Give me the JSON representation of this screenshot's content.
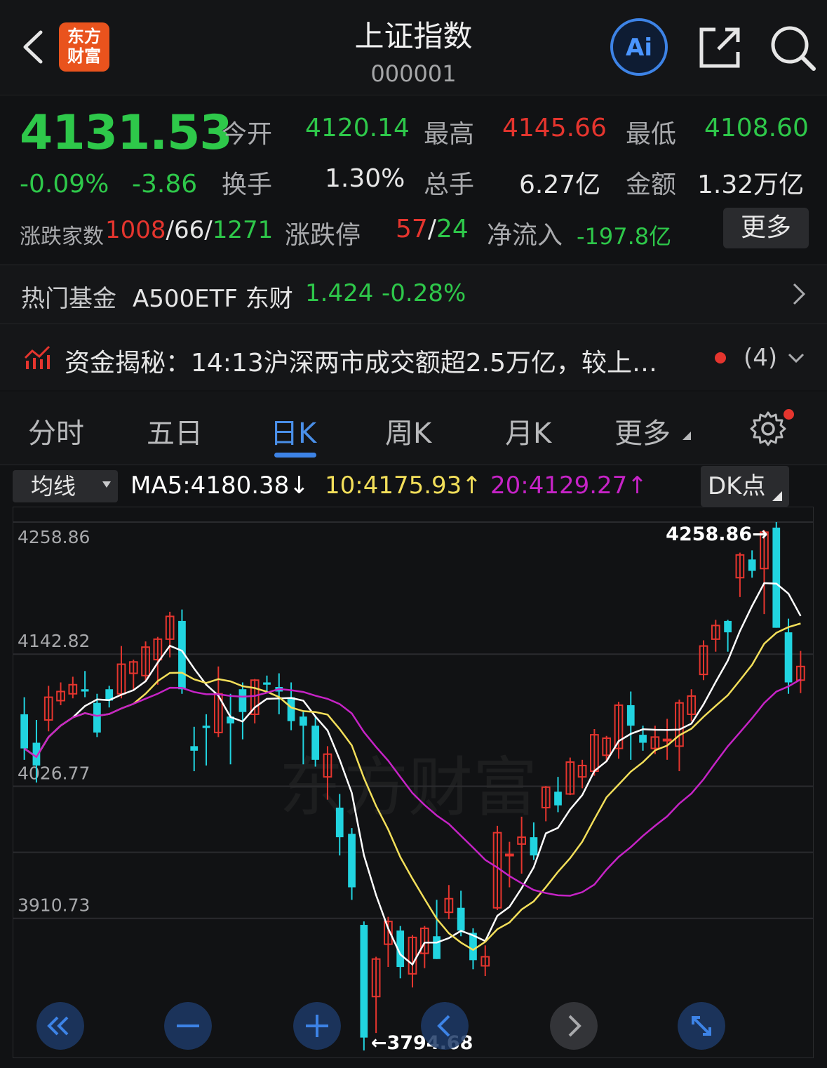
{
  "header": {
    "logo_line1": "东方",
    "logo_line2": "财富",
    "title": "上证指数",
    "code": "000001",
    "ai_label": "Ai"
  },
  "quote": {
    "price": "4131.53",
    "change_pct": "-0.09%",
    "change": "-3.86",
    "open_label": "今开",
    "open": "4120.14",
    "high_label": "最高",
    "high": "4145.66",
    "low_label": "最低",
    "low": "4108.60",
    "turnover_label": "换手",
    "turnover": "1.30%",
    "volume_label": "总手",
    "volume": "6.27亿",
    "amount_label": "金额",
    "amount": "1.32万亿",
    "breadth_label": "涨跌家数",
    "breadth_up": "1008",
    "breadth_flat": "66",
    "breadth_down": "1271",
    "limit_label": "涨跌停",
    "limit_up": "57",
    "limit_down": "24",
    "inflow_label": "净流入",
    "inflow": "-197.8亿",
    "more_label": "更多"
  },
  "fund": {
    "label": "热门基金",
    "name": "A500ETF 东财",
    "price": "1.424",
    "change": "-0.28%"
  },
  "news": {
    "text": "资金揭秘：14:13沪深两市成交额超2.5万亿，较上…",
    "count": "(4)"
  },
  "tabs": [
    "分时",
    "五日",
    "日K",
    "周K",
    "月K",
    "更多"
  ],
  "ma": {
    "type_label": "均线",
    "ma5": "MA5:4180.38",
    "ma5_arrow": "↓",
    "ma10": "10:4175.93",
    "ma10_arrow": "↑",
    "ma20": "20:4129.27",
    "ma20_arrow": "↑",
    "dk_label": "DK点"
  },
  "colors": {
    "up": "#e5352e",
    "down": "#2ec84a",
    "candle_down": "#21d4e0",
    "ma5": "#ffffff",
    "ma10": "#f3df5a",
    "ma20": "#c623c6",
    "accent": "#3d83e6"
  },
  "chart_data": {
    "type": "candlestick",
    "y_ticks": [
      "4258.86",
      "4142.82",
      "4026.77",
      "3910.73"
    ],
    "ylim": [
      3794.68,
      4258.86
    ],
    "max_label": "4258.86",
    "min_label": "3794.68",
    "grid": true,
    "candles": [
      {
        "o": 4090,
        "c": 4060,
        "h": 4105,
        "l": 4050
      },
      {
        "o": 4065,
        "c": 4045,
        "h": 4085,
        "l": 4030
      },
      {
        "o": 4085,
        "c": 4105,
        "h": 4115,
        "l": 4075
      },
      {
        "o": 4102,
        "c": 4110,
        "h": 4118,
        "l": 4098
      },
      {
        "o": 4108,
        "c": 4116,
        "h": 4123,
        "l": 4104
      },
      {
        "o": 4112,
        "c": 4110,
        "h": 4128,
        "l": 4105
      },
      {
        "o": 4100,
        "c": 4074,
        "h": 4108,
        "l": 4070
      },
      {
        "o": 4112,
        "c": 4102,
        "h": 4115,
        "l": 4096
      },
      {
        "o": 4108,
        "c": 4134,
        "h": 4150,
        "l": 4104
      },
      {
        "o": 4126,
        "c": 4136,
        "h": 4138,
        "l": 4111
      },
      {
        "o": 4124,
        "c": 4149,
        "h": 4154,
        "l": 4119
      },
      {
        "o": 4138,
        "c": 4156,
        "h": 4158,
        "l": 4116
      },
      {
        "o": 4156,
        "c": 4176,
        "h": 4180,
        "l": 4140
      },
      {
        "o": 4172,
        "c": 4112,
        "h": 4182,
        "l": 4108
      },
      {
        "o": 4062,
        "c": 4058,
        "h": 4079,
        "l": 4040
      },
      {
        "o": 4080,
        "c": 4078,
        "h": 4090,
        "l": 4045
      },
      {
        "o": 4074,
        "c": 4108,
        "h": 4132,
        "l": 4070
      },
      {
        "o": 4088,
        "c": 4082,
        "h": 4108,
        "l": 4046
      },
      {
        "o": 4112,
        "c": 4092,
        "h": 4118,
        "l": 4068
      },
      {
        "o": 4090,
        "c": 4120,
        "h": 4121,
        "l": 4082
      },
      {
        "o": 4118,
        "c": 4116,
        "h": 4124,
        "l": 4110
      },
      {
        "o": 4114,
        "c": 4110,
        "h": 4126,
        "l": 4090
      },
      {
        "o": 4105,
        "c": 4084,
        "h": 4118,
        "l": 4076
      },
      {
        "o": 4088,
        "c": 4080,
        "h": 4092,
        "l": 4046
      },
      {
        "o": 4080,
        "c": 4050,
        "h": 4088,
        "l": 4044
      },
      {
        "o": 4035,
        "c": 4055,
        "h": 4062,
        "l": 4015
      },
      {
        "o": 4008,
        "c": 3982,
        "h": 4020,
        "l": 3966
      },
      {
        "o": 3985,
        "c": 3938,
        "h": 3990,
        "l": 3927
      },
      {
        "o": 3905,
        "c": 3806,
        "h": 3908,
        "l": 3794.68
      },
      {
        "o": 3842,
        "c": 3875,
        "h": 3877,
        "l": 3810
      },
      {
        "o": 3888,
        "c": 3908,
        "h": 3912,
        "l": 3868
      },
      {
        "o": 3900,
        "c": 3868,
        "h": 3904,
        "l": 3858
      },
      {
        "o": 3862,
        "c": 3894,
        "h": 3896,
        "l": 3850
      },
      {
        "o": 3880,
        "c": 3902,
        "h": 3904,
        "l": 3867
      },
      {
        "o": 3895,
        "c": 3875,
        "h": 3927,
        "l": 3875
      },
      {
        "o": 3916,
        "c": 3928,
        "h": 3940,
        "l": 3910
      },
      {
        "o": 3920,
        "c": 3900,
        "h": 3935,
        "l": 3895
      },
      {
        "o": 3898,
        "c": 3874,
        "h": 3902,
        "l": 3866
      },
      {
        "o": 3869,
        "c": 3877,
        "h": 3887,
        "l": 3860
      },
      {
        "o": 3920,
        "c": 3986,
        "h": 3992,
        "l": 3918
      },
      {
        "o": 3966,
        "c": 3967,
        "h": 3978,
        "l": 3938
      },
      {
        "o": 3976,
        "c": 3982,
        "h": 4000,
        "l": 3950
      },
      {
        "o": 3982,
        "c": 3966,
        "h": 3995,
        "l": 3962
      },
      {
        "o": 4008,
        "c": 4026,
        "h": 4027,
        "l": 3996
      },
      {
        "o": 4022,
        "c": 4010,
        "h": 4035,
        "l": 4004
      },
      {
        "o": 4020,
        "c": 4048,
        "h": 4052,
        "l": 4019
      },
      {
        "o": 4035,
        "c": 4045,
        "h": 4050,
        "l": 4025
      },
      {
        "o": 4040,
        "c": 4072,
        "h": 4077,
        "l": 4036
      },
      {
        "o": 4054,
        "c": 4069,
        "h": 4071,
        "l": 4048
      },
      {
        "o": 4060,
        "c": 4098,
        "h": 4101,
        "l": 4051
      },
      {
        "o": 4098,
        "c": 4080,
        "h": 4110,
        "l": 4050
      },
      {
        "o": 4072,
        "c": 4065,
        "h": 4080,
        "l": 4058
      },
      {
        "o": 4060,
        "c": 4070,
        "h": 4080,
        "l": 4055
      },
      {
        "o": 4068,
        "c": 4068,
        "h": 4086,
        "l": 4050
      },
      {
        "o": 4062,
        "c": 4100,
        "h": 4103,
        "l": 4040
      },
      {
        "o": 4090,
        "c": 4106,
        "h": 4112,
        "l": 4084
      },
      {
        "o": 4125,
        "c": 4150,
        "h": 4155,
        "l": 4120
      },
      {
        "o": 4156,
        "c": 4168,
        "h": 4173,
        "l": 4145
      },
      {
        "o": 4172,
        "c": 4162,
        "h": 4173,
        "l": 4145
      },
      {
        "o": 4210,
        "c": 4230,
        "h": 4232,
        "l": 4193
      },
      {
        "o": 4226,
        "c": 4216,
        "h": 4234,
        "l": 4210
      },
      {
        "o": 4218,
        "c": 4250,
        "h": 4252,
        "l": 4178
      },
      {
        "o": 4254,
        "c": 4166,
        "h": 4258.86,
        "l": 4166
      },
      {
        "o": 4162,
        "c": 4118,
        "h": 4174,
        "l": 4108
      },
      {
        "o": 4120,
        "c": 4132,
        "h": 4145.66,
        "l": 4108.6
      }
    ]
  },
  "watermark": "东方财富"
}
